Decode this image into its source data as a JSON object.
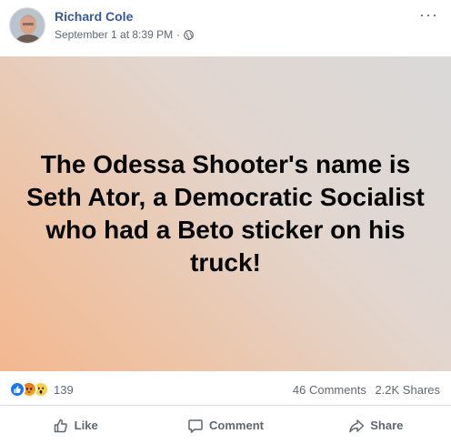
{
  "post": {
    "author": "Richard Cole",
    "timestamp": "September 1 at 8:39 PM",
    "separator": "·",
    "privacy_icon": "globe-icon",
    "more_icon": "more-options-icon",
    "more_label": "···",
    "card_text": "The Odessa Shooter's name is Seth Ator, a Democratic Socialist who had a Beto sticker on his truck!",
    "card_colors": [
      "#d9d9d9",
      "#f3b88f"
    ]
  },
  "stats": {
    "reactions": [
      "like",
      "angry",
      "wow"
    ],
    "reaction_count": "139",
    "comments": "46 Comments",
    "shares": "2.2K Shares"
  },
  "actions": {
    "like": "Like",
    "comment": "Comment",
    "share": "Share"
  },
  "colors": {
    "author_link": "#385898",
    "like_blue": "#1877f2",
    "muted": "#606770"
  }
}
